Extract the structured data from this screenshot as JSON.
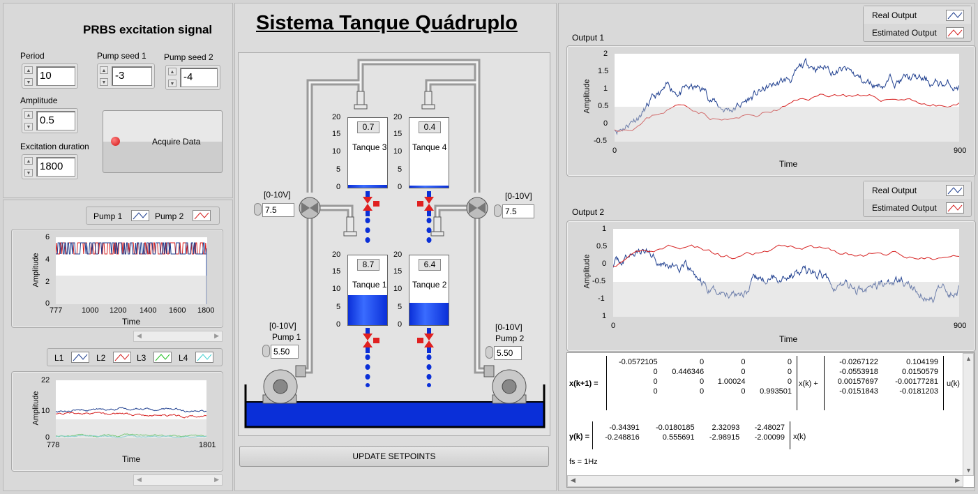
{
  "left": {
    "title": "PRBS excitation signal",
    "period": {
      "label": "Period",
      "value": "10"
    },
    "pump_seed_1": {
      "label": "Pump seed 1",
      "value": "-3"
    },
    "pump_seed_2": {
      "label": "Pump seed 2",
      "value": "-4"
    },
    "amplitude": {
      "label": "Amplitude",
      "value": "0.5"
    },
    "excitation_duration": {
      "label": "Excitation duration",
      "value": "1800"
    },
    "acquire_button": "Acquire Data",
    "pump_chart": {
      "legend": [
        "Pump 1",
        "Pump 2"
      ],
      "ylabel": "Amplitude",
      "xlabel": "Time",
      "yticks": [
        "6",
        "4",
        "2",
        "0"
      ],
      "xticks": [
        "777",
        "1000",
        "1200",
        "1400",
        "1600",
        "1800"
      ]
    },
    "level_chart": {
      "legend": [
        "L1",
        "L2",
        "L3",
        "L4"
      ],
      "ylabel": "Amplitude",
      "xlabel": "Time",
      "yticks": [
        "22",
        "10",
        "0"
      ],
      "xticks": [
        "778",
        "1801"
      ]
    }
  },
  "center": {
    "title": "Sistema Tanque Quádruplo",
    "tank_scale": [
      "20",
      "15",
      "10",
      "5",
      "0"
    ],
    "tanks": [
      {
        "name": "Tanque 3",
        "value": "0.7",
        "level": 0.04
      },
      {
        "name": "Tanque 4",
        "value": "0.4",
        "level": 0.03
      },
      {
        "name": "Tanque 1",
        "value": "8.7",
        "level": 0.435
      },
      {
        "name": "Tanque 2",
        "value": "6.4",
        "level": 0.32
      }
    ],
    "valve_left": {
      "range": "[0-10V]",
      "value": "7.5"
    },
    "valve_right": {
      "range": "[0-10V]",
      "value": "7.5"
    },
    "pump1": {
      "range": "[0-10V]",
      "name": "Pump 1",
      "value": "5.50"
    },
    "pump2": {
      "range": "[0-10V]",
      "name": "Pump 2",
      "value": "5.50"
    },
    "update_button": "UPDATE SETPOINTS"
  },
  "right": {
    "output1": {
      "title": "Output 1",
      "legend": [
        "Real Output",
        "Estimated Output"
      ],
      "ylabel": "Amplitude",
      "xlabel": "Time",
      "yticks": [
        "2",
        "1.5",
        "1",
        "0.5",
        "0",
        "-0.5"
      ],
      "xticks": [
        "0",
        "900"
      ]
    },
    "output2": {
      "title": "Output 2",
      "legend": [
        "Real Output",
        "Estimated Output"
      ],
      "ylabel": "Amplitude",
      "xlabel": "Time",
      "yticks": [
        "1",
        "0.5",
        "0",
        "-0.5",
        "-1",
        "1"
      ],
      "xticks": [
        "0",
        "900"
      ]
    },
    "model": {
      "state_eq_lhs": "x(k+1) =",
      "A": [
        [
          "-0.0572105",
          "0",
          "0",
          "0"
        ],
        [
          "0",
          "0.446346",
          "0",
          "0"
        ],
        [
          "0",
          "0",
          "1.00024",
          "0"
        ],
        [
          "0",
          "0",
          "0",
          "0.993501"
        ]
      ],
      "xk_plus": "x(k) +",
      "B": [
        [
          "-0.0267122",
          "0.104199"
        ],
        [
          "-0.0553918",
          "0.0150579"
        ],
        [
          "0.00157697",
          "-0.00177281"
        ],
        [
          "-0.0151843",
          "-0.0181203"
        ]
      ],
      "uk": "u(k)",
      "out_eq_lhs": "y(k) =",
      "C": [
        [
          "-0.34391",
          "-0.0180185",
          "2.32093",
          "-2.48027"
        ],
        [
          "-0.248816",
          "0.555691",
          "-2.98915",
          "-2.00099"
        ]
      ],
      "xk": "x(k)",
      "fs": "fs = 1Hz"
    }
  },
  "colors": {
    "real": "#1f3f8f",
    "estimated": "#d62020",
    "pump1": "#1f3f8f",
    "pump2": "#d62020",
    "water": "#0a2fd8",
    "l3": "#20c020",
    "l4": "#40d0d0"
  }
}
